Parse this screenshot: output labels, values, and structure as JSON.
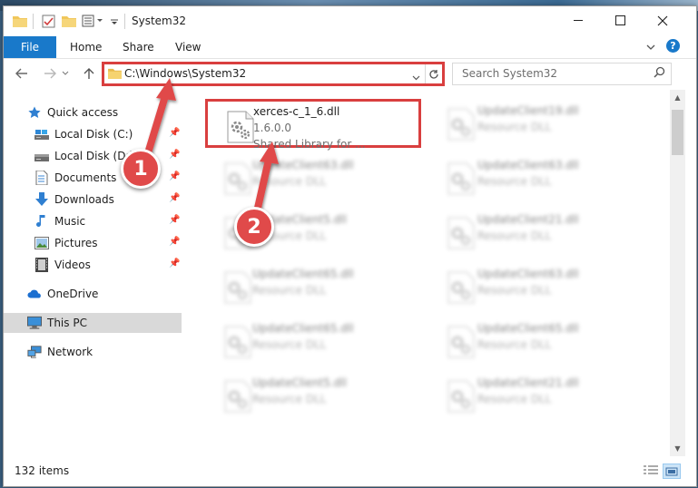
{
  "window": {
    "title": "System32"
  },
  "ribbon": {
    "tabs": [
      {
        "label": "File"
      },
      {
        "label": "Home"
      },
      {
        "label": "Share"
      },
      {
        "label": "View"
      }
    ],
    "help_glyph": "?"
  },
  "address": {
    "path": "C:\\Windows\\System32"
  },
  "search": {
    "placeholder": "Search System32"
  },
  "nav": {
    "quick_access": "Quick access",
    "items": [
      {
        "label": "Local Disk (C:)",
        "icon": "drive-icon"
      },
      {
        "label": "Local Disk (D:)",
        "icon": "drive-icon"
      },
      {
        "label": "Documents",
        "icon": "documents-icon"
      },
      {
        "label": "Downloads",
        "icon": "downloads-icon"
      },
      {
        "label": "Music",
        "icon": "music-icon"
      },
      {
        "label": "Pictures",
        "icon": "pictures-icon"
      },
      {
        "label": "Videos",
        "icon": "videos-icon"
      }
    ],
    "onedrive": "OneDrive",
    "this_pc": "This PC",
    "network": "Network"
  },
  "files": [
    {
      "name": "xerces-c_1_6.dll",
      "line2": "1.6.0.0",
      "line3": "Shared Library for ..."
    },
    {
      "name": "UpdateClient19.dll",
      "line2": "Resource DLL"
    },
    {
      "name": "UpdateClient63.dll",
      "line2": "Resource DLL"
    },
    {
      "name": "UpdateClient63.dll",
      "line2": "Resource DLL"
    },
    {
      "name": "UpdateClient5.dll",
      "line2": "Resource DLL"
    },
    {
      "name": "UpdateClient21.dll",
      "line2": "Resource DLL"
    },
    {
      "name": "UpdateClient65.dll",
      "line2": "Resource DLL"
    },
    {
      "name": "UpdateClient63.dll",
      "line2": "Resource DLL"
    },
    {
      "name": "UpdateClient65.dll",
      "line2": "Resource DLL"
    },
    {
      "name": "UpdateClient65.dll",
      "line2": "Resource DLL"
    },
    {
      "name": "UpdateClient5.dll",
      "line2": "Resource DLL"
    },
    {
      "name": "UpdateClient21.dll",
      "line2": "Resource DLL"
    }
  ],
  "status": {
    "item_count": "132 items"
  },
  "annotations": {
    "step1": "1",
    "step2": "2",
    "color": "#e04a4a"
  }
}
